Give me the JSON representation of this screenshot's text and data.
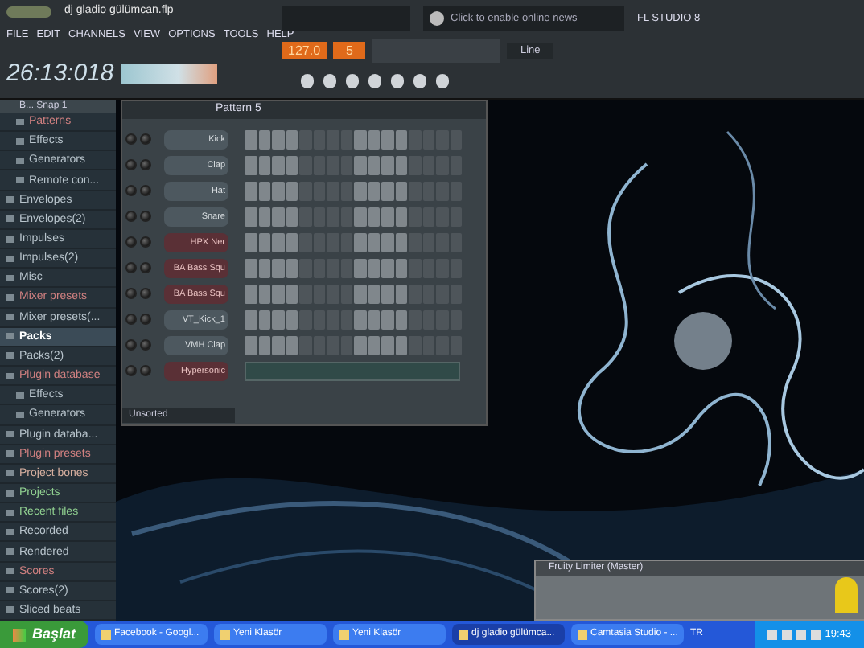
{
  "fl_window": {
    "title": "dj gladio gülümcan.flp",
    "menu": [
      "FILE",
      "EDIT",
      "CHANNELS",
      "VIEW",
      "OPTIONS",
      "TOOLS",
      "HELP"
    ],
    "time": "26:13:018",
    "tempo": "127.0",
    "pattern_number": "5",
    "news": "Click to enable online news",
    "brand": "FL STUDIO 8",
    "input": "Line"
  },
  "browser": {
    "title": "B... Snap 1",
    "partial_branch": [
      {
        "label": "Patterns",
        "color": "#d08080",
        "selected": false
      },
      {
        "label": "Effects",
        "color": "#b8c4cc",
        "selected": false
      },
      {
        "label": "Generators",
        "color": "#b8c4cc",
        "selected": false
      },
      {
        "label": "Remote con...",
        "color": "#b8c4cc",
        "selected": false
      }
    ],
    "items": [
      {
        "label": "Envelopes",
        "color": "#b8c4cc",
        "selected": false
      },
      {
        "label": "Envelopes(2)",
        "color": "#b8c4cc",
        "selected": false
      },
      {
        "label": "Impulses",
        "color": "#b8c4cc",
        "selected": false
      },
      {
        "label": "Impulses(2)",
        "color": "#b8c4cc",
        "selected": false
      },
      {
        "label": "Misc",
        "color": "#b8c4cc",
        "selected": false
      },
      {
        "label": "Mixer presets",
        "color": "#d08080",
        "selected": false
      },
      {
        "label": "Mixer presets(...",
        "color": "#b8c4cc",
        "selected": false
      },
      {
        "label": "Packs",
        "color": "#ffffff",
        "selected": true
      },
      {
        "label": "Packs(2)",
        "color": "#b8c4cc",
        "selected": false
      },
      {
        "label": "Plugin database",
        "color": "#d08080",
        "selected": false,
        "children": [
          {
            "label": "Effects",
            "color": "#b8c4cc",
            "selected": false
          },
          {
            "label": "Generators",
            "color": "#b8c4cc",
            "selected": false
          }
        ]
      },
      {
        "label": "Plugin databa...",
        "color": "#b8c4cc",
        "selected": false
      },
      {
        "label": "Plugin presets",
        "color": "#d08080",
        "selected": false
      },
      {
        "label": "Project bones",
        "color": "#d8b0a0",
        "selected": false
      },
      {
        "label": "Projects",
        "color": "#90d090",
        "selected": false
      },
      {
        "label": "Recent files",
        "color": "#90d090",
        "selected": false
      },
      {
        "label": "Recorded",
        "color": "#b8c4cc",
        "selected": false
      },
      {
        "label": "Rendered",
        "color": "#b8c4cc",
        "selected": false
      },
      {
        "label": "Scores",
        "color": "#d08080",
        "selected": false
      },
      {
        "label": "Scores(2)",
        "color": "#b8c4cc",
        "selected": false
      },
      {
        "label": "Sliced beats",
        "color": "#b8c4cc",
        "selected": false
      }
    ]
  },
  "step_sequencer": {
    "title": "Pattern 5",
    "filter": "Unsorted",
    "channels": [
      {
        "name": "Kick",
        "kind": "sampler"
      },
      {
        "name": "Clap",
        "kind": "sampler"
      },
      {
        "name": "Hat",
        "kind": "sampler"
      },
      {
        "name": "Snare",
        "kind": "sampler"
      },
      {
        "name": "HPX Ner",
        "kind": "plugin"
      },
      {
        "name": "BA Bass Squ",
        "kind": "plugin"
      },
      {
        "name": "BA Bass Squ",
        "kind": "plugin"
      },
      {
        "name": "VT_Kick_1",
        "kind": "sampler"
      },
      {
        "name": "VMH Clap",
        "kind": "sampler"
      },
      {
        "name": "Hypersonic",
        "kind": "pianoroll"
      }
    ]
  },
  "limiter_window": {
    "title": "Fruity Limiter (Master)"
  },
  "taskbar": {
    "start": "Başlat",
    "tasks": [
      {
        "label": "Facebook - Googl...",
        "selected": false
      },
      {
        "label": "Yeni Klasör",
        "selected": false
      },
      {
        "label": "Yeni Klasör",
        "selected": false
      },
      {
        "label": "dj gladio gülümca...",
        "selected": true
      },
      {
        "label": "Camtasia Studio - ...",
        "selected": false
      }
    ],
    "language": "TR",
    "clock": "19:43"
  }
}
